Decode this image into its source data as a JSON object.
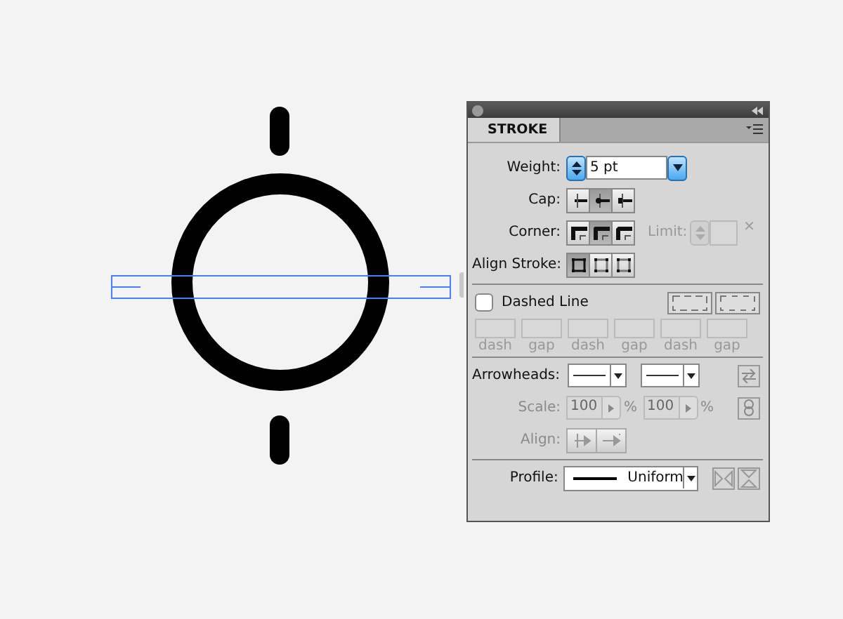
{
  "panel": {
    "tab": "STROKE",
    "weight": {
      "label": "Weight:",
      "value": "5 pt"
    },
    "cap": {
      "label": "Cap:",
      "options": [
        {
          "selected": false
        },
        {
          "selected": true
        },
        {
          "selected": false
        }
      ]
    },
    "corner": {
      "label": "Corner:",
      "options": [
        {
          "selected": false
        },
        {
          "selected": true
        },
        {
          "selected": false
        }
      ],
      "limit_label": "Limit:",
      "limit_close": "×"
    },
    "align_stroke": {
      "label": "Align Stroke:",
      "options": [
        {
          "selected": true
        },
        {
          "selected": false
        },
        {
          "selected": false
        }
      ]
    },
    "dashed_line": {
      "label": "Dashed Line",
      "checked": false,
      "fields": [
        {
          "label": "dash"
        },
        {
          "label": "gap"
        },
        {
          "label": "dash"
        },
        {
          "label": "gap"
        },
        {
          "label": "dash"
        },
        {
          "label": "gap"
        }
      ]
    },
    "arrowheads": {
      "label": "Arrowheads:"
    },
    "scale": {
      "label": "Scale:",
      "values": [
        {
          "value": "100",
          "unit": "%"
        },
        {
          "value": "100",
          "unit": "%"
        }
      ],
      "disabled": true
    },
    "align": {
      "label": "Align:"
    },
    "profile": {
      "label": "Profile:",
      "value": "Uniform"
    }
  }
}
